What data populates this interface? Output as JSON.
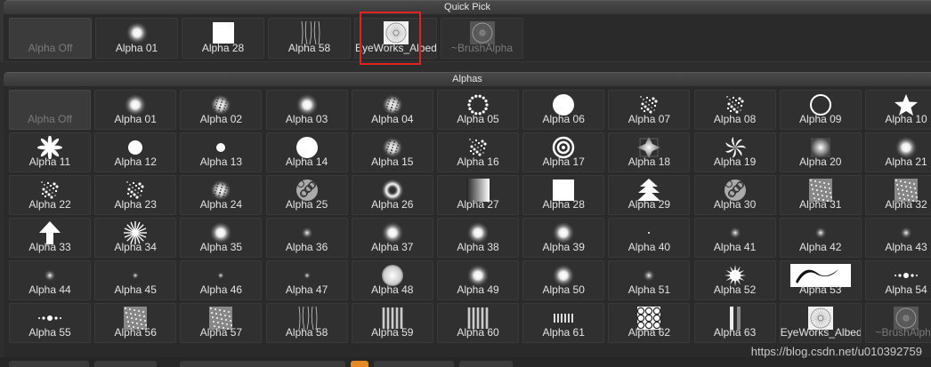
{
  "quick_pick": {
    "title": "Quick Pick",
    "items": [
      {
        "label": "Alpha Off",
        "icon": "none",
        "state": "off"
      },
      {
        "label": "Alpha 01",
        "icon": "soft"
      },
      {
        "label": "Alpha 28",
        "icon": "square"
      },
      {
        "label": "Alpha 58",
        "icon": "streaks"
      },
      {
        "label": "EyeWorks_Albed",
        "icon": "iris",
        "selected": true
      },
      {
        "label": "~BrushAlpha",
        "icon": "iris-dim",
        "state": "dim"
      }
    ]
  },
  "alphas": {
    "title": "Alphas",
    "items": [
      {
        "label": "Alpha Off",
        "icon": "none",
        "state": "off"
      },
      {
        "label": "Alpha 01",
        "icon": "soft"
      },
      {
        "label": "Alpha 02",
        "icon": "noisy"
      },
      {
        "label": "Alpha 03",
        "icon": "soft"
      },
      {
        "label": "Alpha 04",
        "icon": "noisy"
      },
      {
        "label": "Alpha 05",
        "icon": "dotring"
      },
      {
        "label": "Alpha 06",
        "icon": "disc"
      },
      {
        "label": "Alpha 07",
        "icon": "speckle"
      },
      {
        "label": "Alpha 08",
        "icon": "speckle"
      },
      {
        "label": "Alpha 09",
        "icon": "ring"
      },
      {
        "label": "Alpha 10",
        "icon": "star"
      },
      {
        "label": "Alpha 11",
        "icon": "pinwheel"
      },
      {
        "label": "Alpha 12",
        "icon": "disc-sm"
      },
      {
        "label": "Alpha 13",
        "icon": "disc-xs"
      },
      {
        "label": "Alpha 14",
        "icon": "disc"
      },
      {
        "label": "Alpha 15",
        "icon": "noisy"
      },
      {
        "label": "Alpha 16",
        "icon": "speckle"
      },
      {
        "label": "Alpha 17",
        "icon": "concentric"
      },
      {
        "label": "Alpha 18",
        "icon": "star4"
      },
      {
        "label": "Alpha 19",
        "icon": "swirl"
      },
      {
        "label": "Alpha 20",
        "icon": "softsquare"
      },
      {
        "label": "Alpha 21",
        "icon": "soft"
      },
      {
        "label": "Alpha 22",
        "icon": "speckle"
      },
      {
        "label": "Alpha 23",
        "icon": "speckle"
      },
      {
        "label": "Alpha 24",
        "icon": "noisy"
      },
      {
        "label": "Alpha 25",
        "icon": "cells"
      },
      {
        "label": "Alpha 26",
        "icon": "donut"
      },
      {
        "label": "Alpha 27",
        "icon": "gradient"
      },
      {
        "label": "Alpha 28",
        "icon": "square"
      },
      {
        "label": "Alpha 29",
        "icon": "tree"
      },
      {
        "label": "Alpha 30",
        "icon": "cells"
      },
      {
        "label": "Alpha 31",
        "icon": "noisesquare"
      },
      {
        "label": "Alpha 32",
        "icon": "noisesquare"
      },
      {
        "label": "Alpha 33",
        "icon": "arrow"
      },
      {
        "label": "Alpha 34",
        "icon": "burst"
      },
      {
        "label": "Alpha 35",
        "icon": "soft"
      },
      {
        "label": "Alpha 36",
        "icon": "dot-soft"
      },
      {
        "label": "Alpha 37",
        "icon": "soft"
      },
      {
        "label": "Alpha 38",
        "icon": "soft"
      },
      {
        "label": "Alpha 39",
        "icon": "soft"
      },
      {
        "label": "Alpha 40",
        "icon": "pixel"
      },
      {
        "label": "Alpha 41",
        "icon": "dot-soft"
      },
      {
        "label": "Alpha 42",
        "icon": "dot-soft"
      },
      {
        "label": "Alpha 43",
        "icon": "dot-soft"
      },
      {
        "label": "Alpha 44",
        "icon": "dot-soft"
      },
      {
        "label": "Alpha 45",
        "icon": "dot-sm"
      },
      {
        "label": "Alpha 46",
        "icon": "dot-sm"
      },
      {
        "label": "Alpha 47",
        "icon": "dot-sm"
      },
      {
        "label": "Alpha 48",
        "icon": "sphere"
      },
      {
        "label": "Alpha 49",
        "icon": "soft"
      },
      {
        "label": "Alpha 50",
        "icon": "soft"
      },
      {
        "label": "Alpha 51",
        "icon": "dot-soft"
      },
      {
        "label": "Alpha 52",
        "icon": "sunburst"
      },
      {
        "label": "Alpha 53",
        "icon": "curve"
      },
      {
        "label": "Alpha 54",
        "icon": "dotline"
      },
      {
        "label": "Alpha 55",
        "icon": "dotline"
      },
      {
        "label": "Alpha 56",
        "icon": "noisesquare"
      },
      {
        "label": "Alpha 57",
        "icon": "noisesquare"
      },
      {
        "label": "Alpha 58",
        "icon": "streaks"
      },
      {
        "label": "Alpha 59",
        "icon": "bars"
      },
      {
        "label": "Alpha 60",
        "icon": "bars"
      },
      {
        "label": "Alpha 61",
        "icon": "bars-sm"
      },
      {
        "label": "Alpha 62",
        "icon": "cells-square"
      },
      {
        "label": "Alpha 63",
        "icon": "bars-v"
      },
      {
        "label": "EyeWorks_Albed",
        "icon": "iris"
      },
      {
        "label": "~BrushAlpha",
        "icon": "iris-dim",
        "state": "dim"
      }
    ]
  },
  "watermark": "https://blog.csdn.net/u010392759",
  "colors": {
    "highlight": "#e0231c",
    "panel_bg": "#2a2a2a",
    "accent": "#e48a25"
  }
}
